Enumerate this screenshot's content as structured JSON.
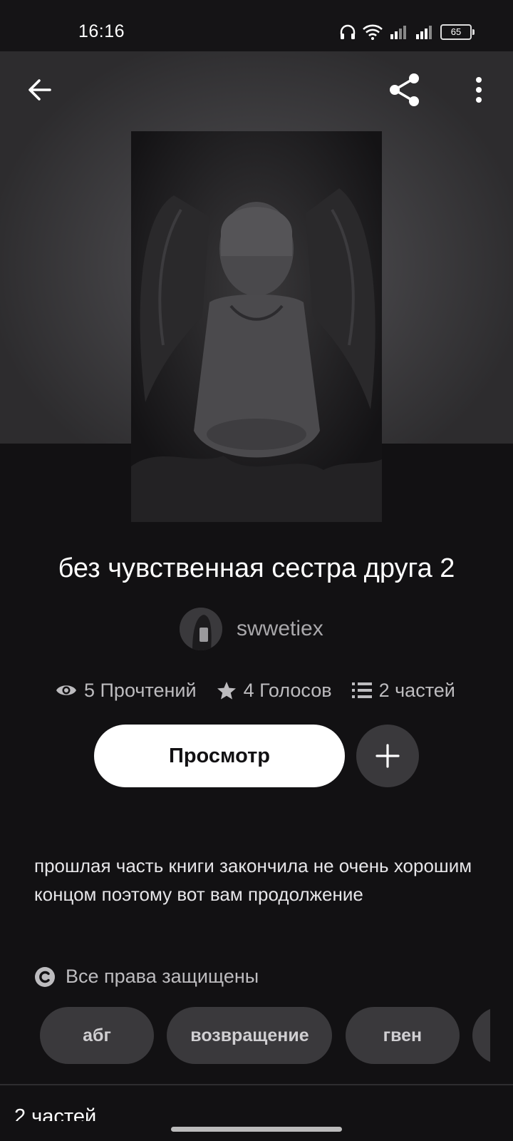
{
  "status_bar": {
    "time": "16:16",
    "battery": "65",
    "icons": [
      "headphones-icon",
      "wifi-icon",
      "signal-icon",
      "signal-icon",
      "battery-icon"
    ]
  },
  "toolbar": {
    "back_icon": "arrow-left-icon",
    "share_icon": "share-icon",
    "more_icon": "more-vertical-icon"
  },
  "story": {
    "title": "без чувственная сестра друга 2",
    "author": "swwetiex",
    "stats": {
      "reads": "5 Прочтений",
      "votes": "4 Голосов",
      "parts": "2 частей"
    },
    "read_button": "Просмотр",
    "description": "прошлая часть книги закончила не очень хорошим концом поэтому вот вам продолжение",
    "rights": "Все права защищены",
    "tags": [
      "абг",
      "возвращение",
      "гвен"
    ]
  },
  "parts_section": {
    "heading": "2 частей"
  },
  "colors": {
    "background": "#121113",
    "surface": "#3a393c",
    "muted_text": "#bdbcbf"
  }
}
